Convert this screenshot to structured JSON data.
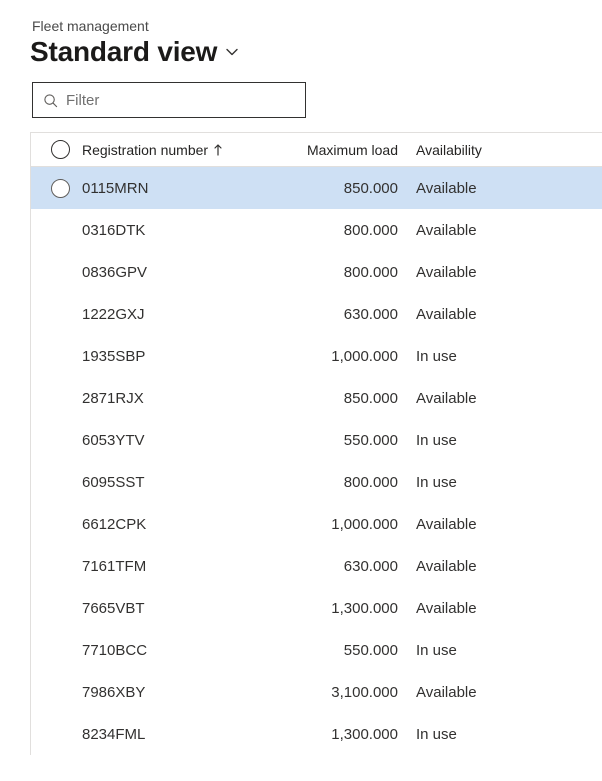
{
  "breadcrumb": "Fleet management",
  "view": {
    "title": "Standard view"
  },
  "filter": {
    "placeholder": "Filter",
    "value": ""
  },
  "columns": {
    "registration": "Registration number",
    "maxload": "Maximum load",
    "availability": "Availability"
  },
  "sort": {
    "column": "registration",
    "direction": "asc"
  },
  "rows": [
    {
      "registration": "0115MRN",
      "maxload": "850.000",
      "availability": "Available",
      "selected": true
    },
    {
      "registration": "0316DTK",
      "maxload": "800.000",
      "availability": "Available",
      "selected": false
    },
    {
      "registration": "0836GPV",
      "maxload": "800.000",
      "availability": "Available",
      "selected": false
    },
    {
      "registration": "1222GXJ",
      "maxload": "630.000",
      "availability": "Available",
      "selected": false
    },
    {
      "registration": "1935SBP",
      "maxload": "1,000.000",
      "availability": "In use",
      "selected": false
    },
    {
      "registration": "2871RJX",
      "maxload": "850.000",
      "availability": "Available",
      "selected": false
    },
    {
      "registration": "6053YTV",
      "maxload": "550.000",
      "availability": "In use",
      "selected": false
    },
    {
      "registration": "6095SST",
      "maxload": "800.000",
      "availability": "In use",
      "selected": false
    },
    {
      "registration": "6612CPK",
      "maxload": "1,000.000",
      "availability": "Available",
      "selected": false
    },
    {
      "registration": "7161TFM",
      "maxload": "630.000",
      "availability": "Available",
      "selected": false
    },
    {
      "registration": "7665VBT",
      "maxload": "1,300.000",
      "availability": "Available",
      "selected": false
    },
    {
      "registration": "7710BCC",
      "maxload": "550.000",
      "availability": "In use",
      "selected": false
    },
    {
      "registration": "7986XBY",
      "maxload": "3,100.000",
      "availability": "Available",
      "selected": false
    },
    {
      "registration": "8234FML",
      "maxload": "1,300.000",
      "availability": "In use",
      "selected": false
    }
  ]
}
